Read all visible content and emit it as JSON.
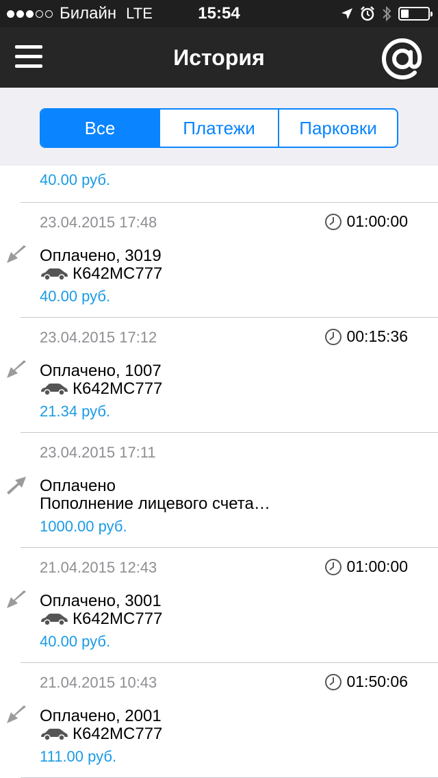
{
  "status_bar": {
    "carrier": "Билайн",
    "network": "LTE",
    "time": "15:54",
    "signal_bars": 3,
    "signal_total": 5,
    "battery_level": 0.3
  },
  "nav": {
    "title": "История",
    "menu_icon": "hamburger-menu-icon",
    "right_icon": "at-sign-icon"
  },
  "tabs": [
    {
      "label": "Все",
      "active": true
    },
    {
      "label": "Платежи",
      "active": false
    },
    {
      "label": "Парковки",
      "active": false
    }
  ],
  "partial_item": {
    "amount": "40.00 руб."
  },
  "items": [
    {
      "date": "23.04.2015 17:48",
      "duration": "01:00:00",
      "title": "Оплачено, 3019",
      "plate": "К642МС777",
      "amount": "40.00 руб.",
      "direction": "outgoing"
    },
    {
      "date": "23.04.2015 17:12",
      "duration": "00:15:36",
      "title": "Оплачено, 1007",
      "plate": "К642МС777",
      "amount": "21.34 руб.",
      "direction": "outgoing"
    },
    {
      "date": "23.04.2015 17:11",
      "duration": "",
      "title": "Оплачено",
      "description": "Пополнение лицевого счета…",
      "amount": "1000.00 руб.",
      "direction": "incoming"
    },
    {
      "date": "21.04.2015 12:43",
      "duration": "01:00:00",
      "title": "Оплачено, 3001",
      "plate": "К642МС777",
      "amount": "40.00 руб.",
      "direction": "outgoing"
    },
    {
      "date": "21.04.2015 10:43",
      "duration": "01:50:06",
      "title": "Оплачено, 2001",
      "plate": "К642МС777",
      "amount": "111.00 руб.",
      "direction": "outgoing"
    }
  ],
  "colors": {
    "accent": "#0a84ff",
    "amount": "#1a9be6",
    "nav_bg": "#262626"
  }
}
